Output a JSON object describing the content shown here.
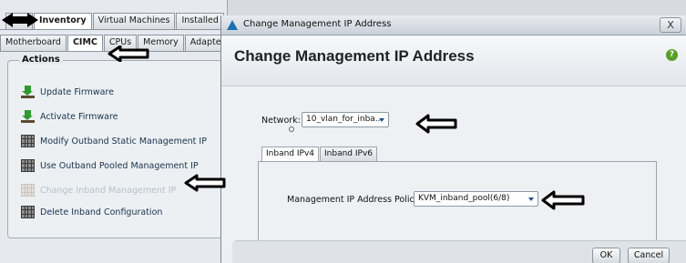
{
  "background_window": {
    "top_tabs": [
      {
        "label": "Inventory"
      },
      {
        "label": "Virtual Machines"
      },
      {
        "label": "Installed"
      }
    ],
    "sub_tabs": [
      {
        "label": "Motherboard"
      },
      {
        "label": "CIMC"
      },
      {
        "label": "CPUs"
      },
      {
        "label": "Memory"
      },
      {
        "label": "Adapters"
      }
    ],
    "actions_title": "Actions",
    "actions": [
      {
        "label": "Update Firmware",
        "icon": "download-icon"
      },
      {
        "label": "Activate Firmware",
        "icon": "download-icon"
      },
      {
        "label": "Modify Outband Static Management IP",
        "icon": "server-grid-icon"
      },
      {
        "label": "Use Outband Pooled Management IP",
        "icon": "server-grid-icon"
      },
      {
        "label": "Change Inband Management IP",
        "icon": "server-grid-icon",
        "state": "disabled"
      },
      {
        "label": "Delete Inband Configuration",
        "icon": "server-grid-icon"
      }
    ]
  },
  "dialog": {
    "window_title": "Change Management IP Address",
    "heading": "Change Management IP Address",
    "help_icon": "?",
    "close_icon": "X",
    "network": {
      "label": "Network:",
      "value": "10_vlan_for_inba..."
    },
    "tabs": [
      {
        "label": "Inband IPv4",
        "active": true
      },
      {
        "label": "Inband IPv6",
        "active": false
      }
    ],
    "policy": {
      "label": "Management IP Address Policy:",
      "value": "KVM_inband_pool(6/8)"
    },
    "buttons": {
      "ok": "OK",
      "cancel": "Cancel"
    }
  },
  "colors": {
    "annotation_arrow": "#000000",
    "link_text": "#17324d",
    "disabled_text": "#b7c0ca",
    "help_green": "#5a9e2a",
    "dropdown_arrow": "#1e4f8c"
  }
}
